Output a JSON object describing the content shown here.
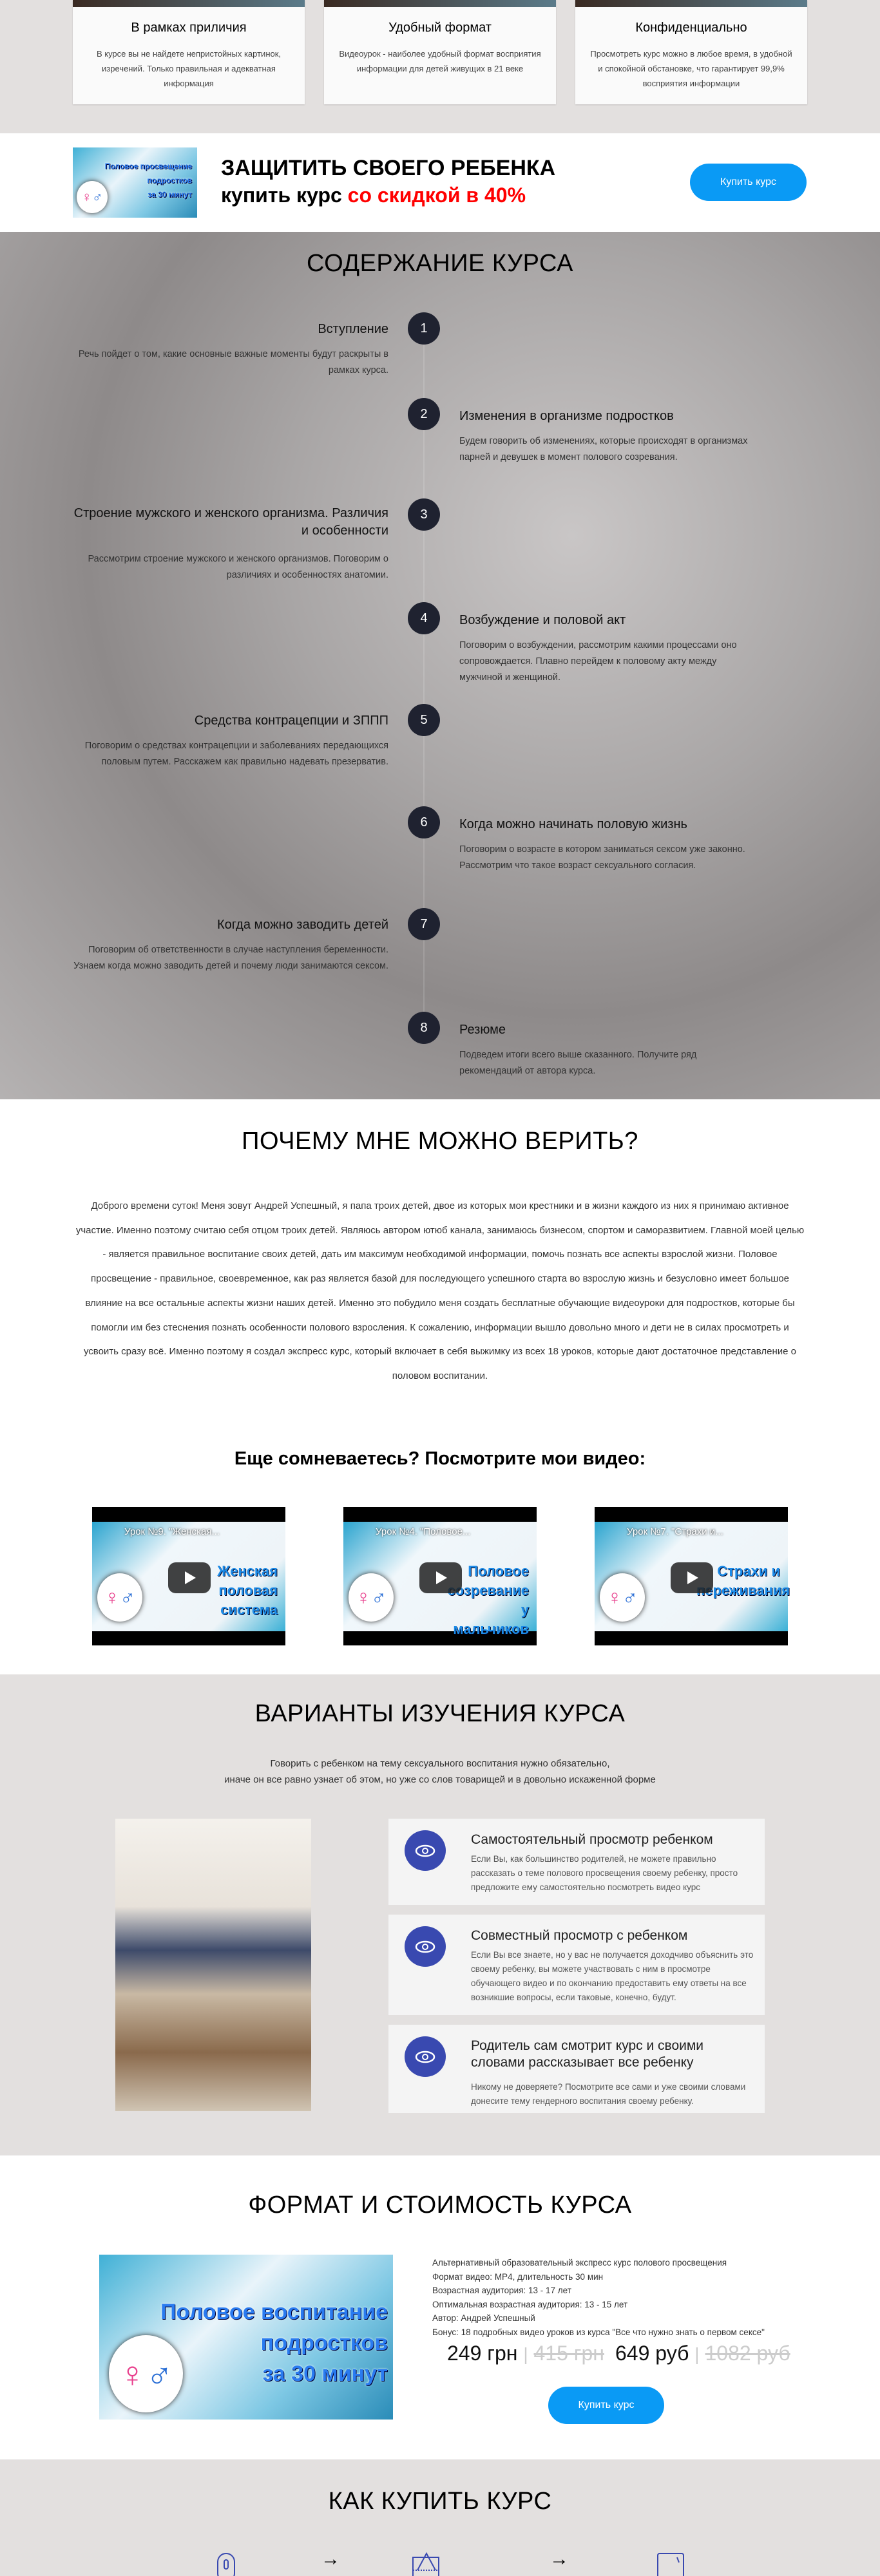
{
  "features": [
    {
      "title": "В рамках приличия",
      "text": "В курсе вы не найдете непристойных картинок, изречений. Только правильная и адекватная информация"
    },
    {
      "title": "Удобный формат",
      "text": "Видеоурок - наиболее удобный формат восприятия информации для детей живущих в 21 веке"
    },
    {
      "title": "Конфиденциально",
      "text": "Просмотреть курс можно в любое время, в удобной и спокойной обстановке, что гарантирует 99,9% восприятия информации"
    }
  ],
  "banner": {
    "cover_lines": [
      "Половое просвещение",
      "подростков",
      "за 30 минут"
    ],
    "title": "ЗАЩИТИТЬ СВОЕГО РЕБЕНКА",
    "subtitle_prefix": "купить курс ",
    "subtitle_accent": "со скидкой в 40%",
    "buy_label": "Купить курс",
    "accent_color": "#ff0000",
    "button_color": "#0a9af5"
  },
  "contents": {
    "title": "СОДЕРЖАНИЕ КУРСА",
    "items": [
      {
        "num": "1",
        "title": "Вступление",
        "text": "Речь пойдет о том, какие основные важные моменты будут раскрыты в рамках курса."
      },
      {
        "num": "2",
        "title": "Изменения в организме подростков",
        "text": "Будем говорить об изменениях, которые происходят в организмах парней и девушек в момент полового созревания."
      },
      {
        "num": "3",
        "title": "Строение мужского и женского организма. Различия и особенности",
        "text": "Рассмотрим строение мужского и женского организмов. Поговорим о различиях и особенностях анатомии."
      },
      {
        "num": "4",
        "title": "Возбуждение и половой акт",
        "text": "Поговорим о возбуждении, рассмотрим какими процессами оно сопровождается. Плавно перейдем к половому акту между мужчиной и женщиной."
      },
      {
        "num": "5",
        "title": "Средства контрацепции и ЗППП",
        "text": "Поговорим о средствах контрацепции и заболеваниях передающихся половым путем. Расскажем как правильно надевать презерватив."
      },
      {
        "num": "6",
        "title": "Когда можно начинать половую жизнь",
        "text": "Поговорим о возрасте в котором заниматься сексом уже законно. Рассмотрим что такое возраст сексуального согласия."
      },
      {
        "num": "7",
        "title": "Когда можно заводить детей",
        "text": "Поговорим об ответственности в случае наступления беременности. Узнаем когда можно заводить детей и почему люди занимаются сексом."
      },
      {
        "num": "8",
        "title": "Резюме",
        "text": "Подведем итоги всего выше сказанного. Получите ряд рекомендаций от автора курса."
      }
    ]
  },
  "trust": {
    "title": "ПОЧЕМУ МНЕ МОЖНО ВЕРИТЬ?",
    "text": "Доброго времени суток! Меня зовут Андрей Успешный, я папа троих детей, двое из которых мои крестники и в жизни каждого из них я принимаю активное участие. Именно поэтому считаю себя отцом троих детей. Являюсь автором ютюб канала, занимаюсь бизнесом, спортом и саморазвитием. Главной моей целью - является правильное воспитание своих детей, дать им максимум необходимой информации, помочь познать все аспекты взрослой жизни. Половое просвещение - правильное, своевременное, как раз является базой для последующего успешного старта во взрослую жизнь и безусловно имеет большое влияние на все остальные аспекты жизни наших детей. Именно это побудило меня создать бесплатные обучающие видеоуроки для подростков, которые бы помогли им без стеснения познать особенности полового взросления. К сожалению, информации вышло довольно много и дети не в силах просмотреть и усвоить сразу всё. Именно поэтому я создал экспресс курс, который включает в себя выжимку из всех 18 уроков, которые дают достаточное представление о половом воспитании.",
    "videos_title": "Еще сомневаетесь? Посмотрите мои видео:",
    "videos": [
      {
        "title": "Урок №9. \"Женская...",
        "overlay": "Женская половая система"
      },
      {
        "title": "Урок №4. \"Половое...",
        "overlay": "Половое созревание у мальчиков"
      },
      {
        "title": "Урок №7. \"Страхи и...",
        "overlay": "Страхи и переживания"
      }
    ]
  },
  "variants": {
    "title": "ВАРИАНТЫ ИЗУЧЕНИЯ КУРСА",
    "subtitle_1": "Говорить с ребенком на тему сексуального воспитания нужно обязательно,",
    "subtitle_2": "иначе он все равно узнает об этом, но уже со слов товарищей и в довольно искаженной форме",
    "icon_color": "#3949b0",
    "items": [
      {
        "title": "Самостоятельный просмотр ребенком",
        "text": "Если Вы, как большинство родителей, не можете правильно рассказать о теме полового просвещения своему ребенку, просто предложите ему самостоятельно посмотреть видео курс"
      },
      {
        "title": "Совместный просмотр с ребенком",
        "text": "Если Вы все знаете, но у вас не получается доходчиво объяснить это своему ребенку, вы можете участвовать с ним в просмотре обучающего видео и по окончанию предоставить ему ответы на все возникшие вопросы, если таковые, конечно, будут."
      },
      {
        "title": "Родитель сам смотрит курс и своими словами рассказывает все ребенку",
        "text": "Никому не доверяете? Посмотрите все сами и уже своими словами донесите тему гендерного воспитания своему ребенку."
      }
    ]
  },
  "format": {
    "title": "ФОРМАТ И СТОИМОСТЬ КУРСА",
    "cover_lines": [
      "Половое воспитание",
      "подростков",
      "за 30 минут"
    ],
    "details": [
      "Альтернативный образовательный экспресс курс полового просвещения",
      "Формат видео: MP4, длительность 30 мин",
      "Возрастная аудитория: 13 - 17 лет",
      "Оптимальная возрастная аудитория: 13 - 15 лет",
      "Автор: Андрей Успешный",
      "Бонус: 18 подробных видео уроков из курса \"Все что нужно знать о первом сексе\""
    ],
    "price_uah": "249 грн",
    "old_price_uah": "415 грн",
    "price_rub": "649 руб",
    "old_price_rub": "1082 руб",
    "separator": "|",
    "buy_label": "Купить курс"
  },
  "how_to_buy": {
    "title": "КАК КУПИТЬ КУРС",
    "arrow": "→"
  }
}
